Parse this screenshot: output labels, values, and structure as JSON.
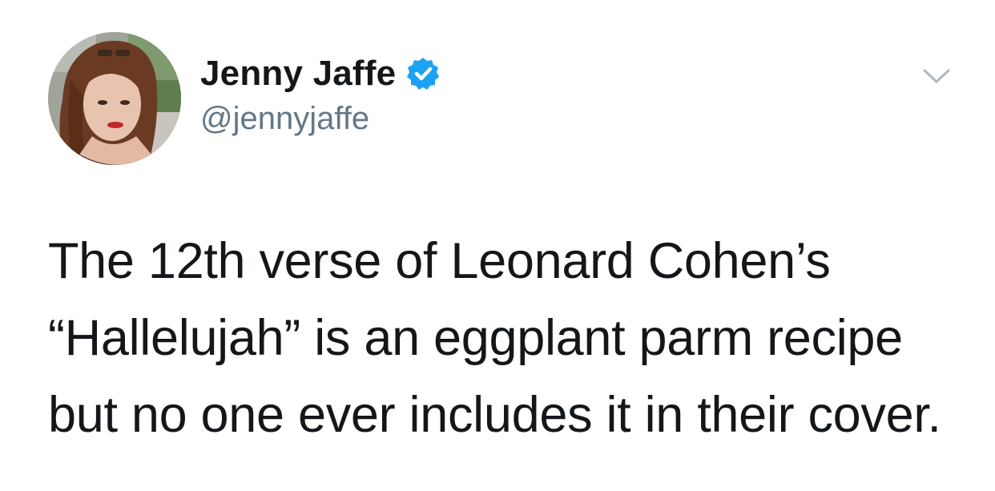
{
  "author": {
    "display_name": "Jenny Jaffe",
    "handle": "@jennyjaffe",
    "verified": true,
    "verified_color": "#1da1f2"
  },
  "icons": {
    "verified": "verified-badge-icon",
    "menu": "chevron-down-icon"
  },
  "tweet": {
    "lines": [
      "The 12th verse of Leonard Cohen’s",
      "“Hallelujah” is an eggplant parm recipe",
      "but no one ever includes it in their cover."
    ]
  },
  "colors": {
    "text": "#14171a",
    "secondary_text": "#657786",
    "chevron": "#aab8c2"
  }
}
